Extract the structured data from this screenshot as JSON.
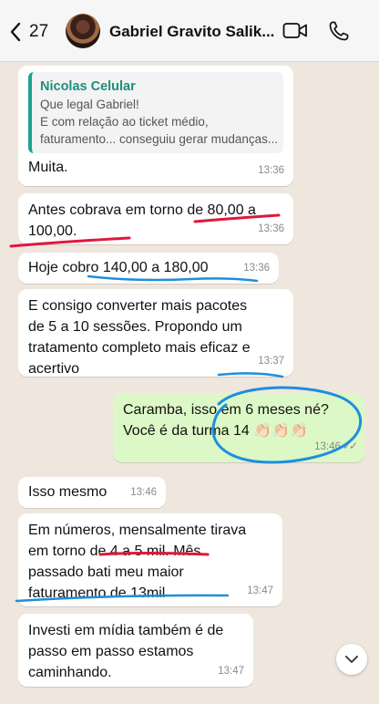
{
  "header": {
    "back_count": "27",
    "contact_name": "Gabriel Gravito Salik..."
  },
  "messages": [
    {
      "direction": "incoming",
      "quoted": {
        "author": "Nicolas Celular",
        "lines": [
          "Que legal Gabriel!",
          "E com relação ao ticket médio,",
          "faturamento... conseguiu gerar mudanças..."
        ]
      },
      "lines": [
        "Muita."
      ],
      "time": "13:36"
    },
    {
      "direction": "incoming",
      "lines": [
        "Antes cobrava em torno de 80,00 a",
        "100,00."
      ],
      "time": "13:36"
    },
    {
      "direction": "incoming",
      "lines": [
        "Hoje cobro 140,00 a 180,00"
      ],
      "time": "13:36"
    },
    {
      "direction": "incoming",
      "lines": [
        "E consigo converter mais pacotes",
        "de 5 a 10 sessões. Propondo um",
        "tratamento completo mais eficaz e",
        "acertivo"
      ],
      "time": "13:37"
    },
    {
      "direction": "outgoing",
      "lines": [
        "Caramba, isso em 6 meses né?",
        "Você é da turma 14 👏🏻👏🏻👏🏻"
      ],
      "time": "13:46",
      "status": "read"
    },
    {
      "direction": "incoming",
      "lines": [
        "Isso mesmo"
      ],
      "time": "13:46"
    },
    {
      "direction": "incoming",
      "lines": [
        "Em números, mensalmente tirava",
        "em torno de 4 a 5 mil. Mês",
        "passado bati meu maior",
        "faturamento de 13mil"
      ],
      "time": "13:47"
    },
    {
      "direction": "incoming",
      "lines": [
        "Investi em mídia também é de",
        "passo em passo estamos",
        "caminhando."
      ],
      "time": "13:47"
    }
  ],
  "colors": {
    "chat_background": "#efe7de",
    "incoming_bubble": "#ffffff",
    "outgoing_bubble": "#dcf8c6",
    "quote_accent": "#1ba38f",
    "annotation_red": "#e0173c",
    "annotation_blue": "#1d8fdc",
    "read_ticks": "#8a8a8a"
  },
  "icons": {
    "back": "chevron-left-icon",
    "video_call": "video-camera-icon",
    "voice_call": "phone-icon",
    "scroll_down": "chevron-down-icon"
  }
}
